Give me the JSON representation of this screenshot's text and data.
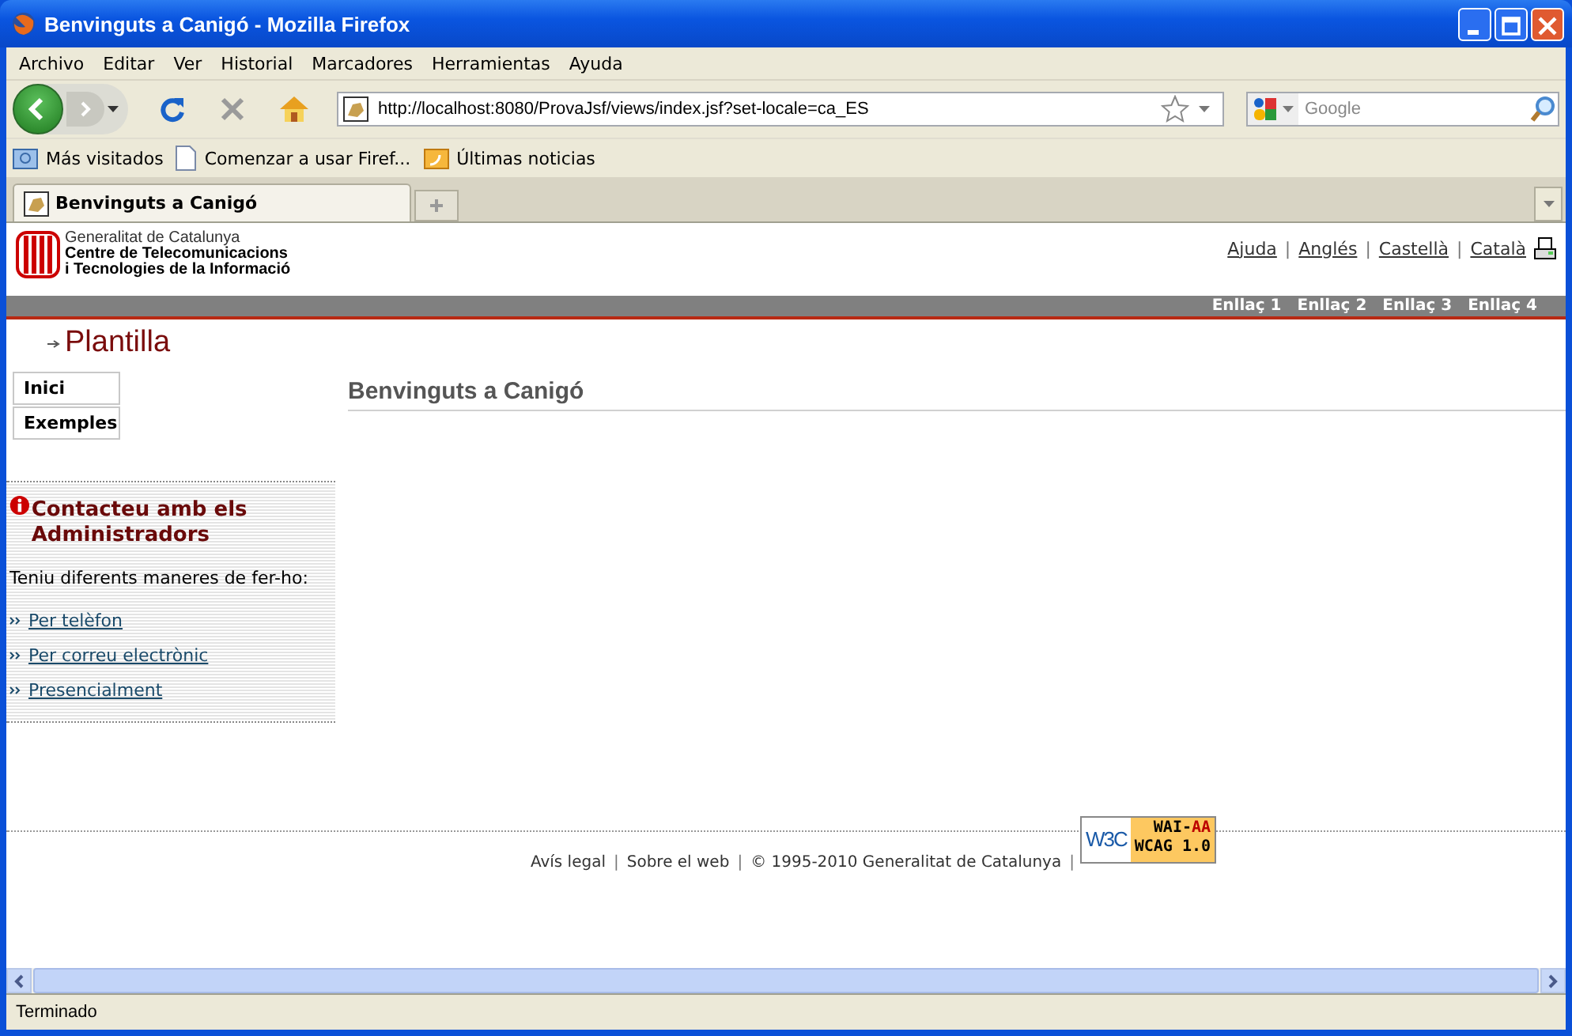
{
  "window": {
    "title": "Benvinguts a Canigó - Mozilla Firefox"
  },
  "menu": [
    "Archivo",
    "Editar",
    "Ver",
    "Historial",
    "Marcadores",
    "Herramientas",
    "Ayuda"
  ],
  "address": {
    "value": "http://localhost:8080/ProvaJsf/views/index.jsf?set-locale=ca_ES"
  },
  "search": {
    "placeholder": "Google"
  },
  "bookmarks": [
    {
      "label": "Más visitados",
      "kind": "folder"
    },
    {
      "label": "Comenzar a usar Firef...",
      "kind": "page"
    },
    {
      "label": "Últimas noticias",
      "kind": "feed"
    }
  ],
  "tabs": [
    {
      "label": "Benvinguts a Canigó",
      "selected": true
    }
  ],
  "page": {
    "logo": [
      "Generalitat de Catalunya",
      "Centre de Telecomunicacions",
      "i Tecnologies de la Informació"
    ],
    "top_links": [
      "Ajuda",
      "Anglés",
      "Castellà",
      "Català"
    ],
    "top_separators": [
      "|",
      "|",
      "|"
    ],
    "footer_separators": [
      "|",
      "|",
      "|"
    ],
    "bar_links": [
      "Enllaç 1",
      "Enllaç 2",
      "Enllaç 3",
      "Enllaç 4"
    ],
    "section": "Plantilla",
    "nav": [
      "Inici",
      "Exemples"
    ],
    "heading": "Benvinguts a Canigó",
    "contact": {
      "title": "Contacteu amb els Administradors",
      "text": "Teniu diferents maneres de fer-ho:",
      "links": [
        "Per telèfon",
        "Per correu electrònic",
        "Presencialment"
      ]
    },
    "footer": [
      "Avís legal",
      "Sobre el web",
      "© 1995-2010 Generalitat de Catalunya"
    ],
    "badge": {
      "logo": "W3C",
      "label": "WAI-",
      "level": "AA",
      "version": "WCAG 1.0"
    }
  },
  "status_bar": "Terminado"
}
